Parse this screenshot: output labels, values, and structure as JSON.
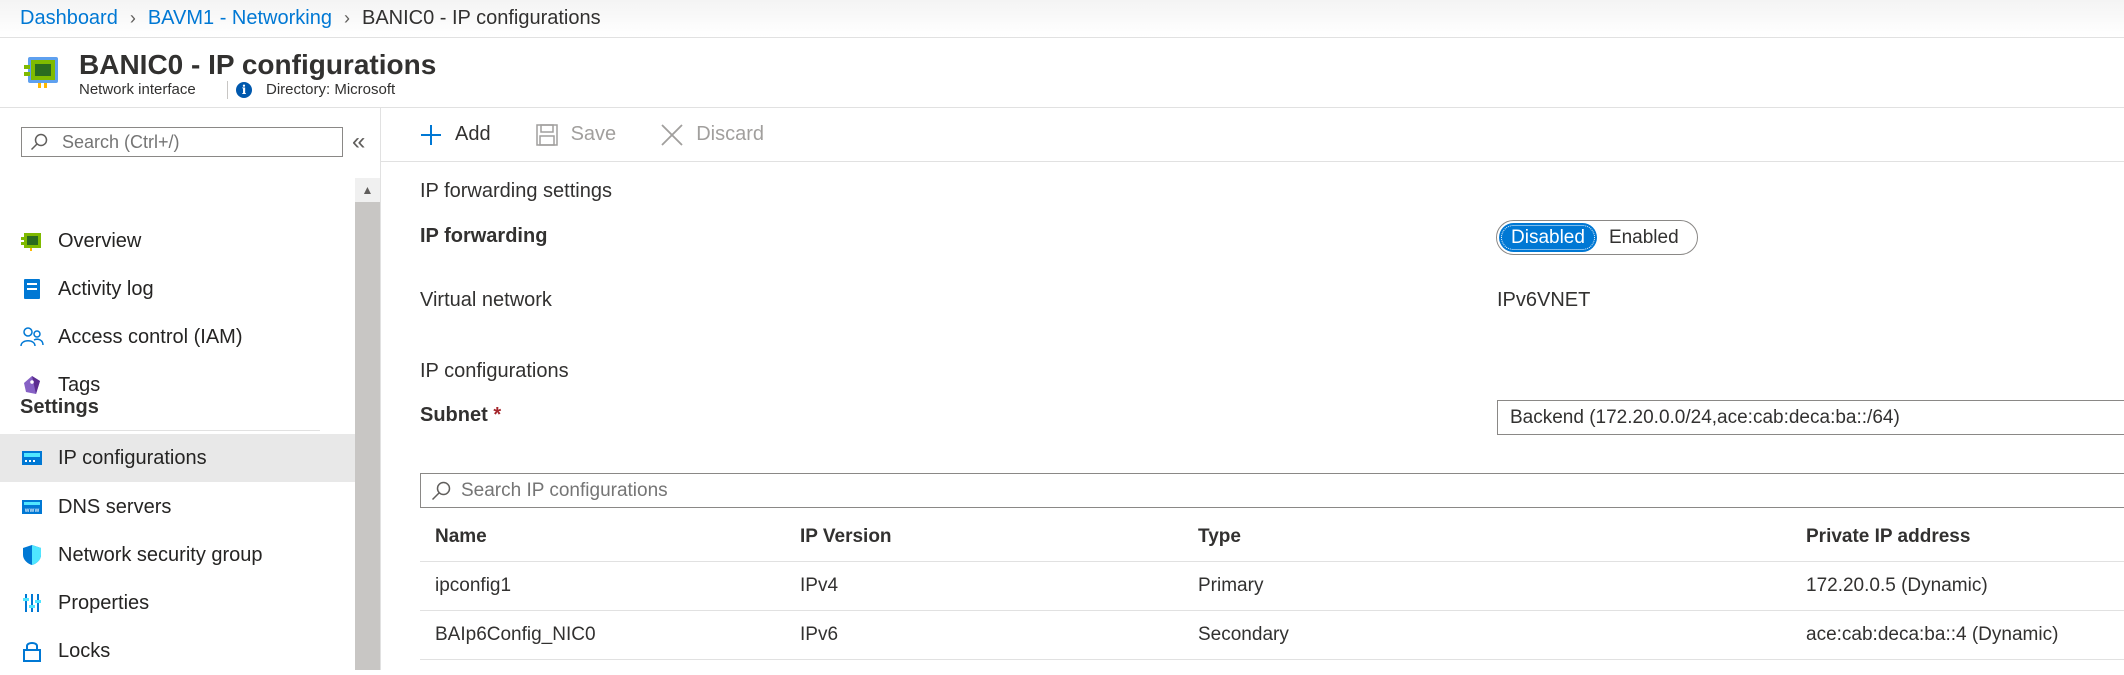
{
  "breadcrumb": {
    "items": [
      "Dashboard",
      "BAVM1 - Networking"
    ],
    "current": "BANIC0 - IP configurations"
  },
  "header": {
    "title": "BANIC0 - IP configurations",
    "subtitle": "Network interface",
    "directory": "Directory: Microsoft"
  },
  "sidebar": {
    "search_placeholder": "Search (Ctrl+/)",
    "items": [
      {
        "label": "Overview",
        "icon": "network-interface-icon"
      },
      {
        "label": "Activity log",
        "icon": "activity-log-icon"
      },
      {
        "label": "Access control (IAM)",
        "icon": "people-icon"
      },
      {
        "label": "Tags",
        "icon": "tag-icon"
      }
    ],
    "section": "Settings",
    "settings_items": [
      {
        "label": "IP configurations",
        "icon": "ip-config-icon",
        "active": true
      },
      {
        "label": "DNS servers",
        "icon": "dns-icon"
      },
      {
        "label": "Network security group",
        "icon": "shield-icon"
      },
      {
        "label": "Properties",
        "icon": "properties-icon"
      },
      {
        "label": "Locks",
        "icon": "lock-icon"
      }
    ]
  },
  "toolbar": {
    "add_label": "Add",
    "save_label": "Save",
    "discard_label": "Discard"
  },
  "main": {
    "ip_forwarding_section": "IP forwarding settings",
    "ip_forwarding_label": "IP forwarding",
    "toggle_disabled": "Disabled",
    "toggle_enabled": "Enabled",
    "toggle_selected": "Disabled",
    "virtual_network_label": "Virtual network",
    "virtual_network_value": "IPv6VNET",
    "ip_config_section": "IP configurations",
    "subnet_label": "Subnet",
    "subnet_required": "*",
    "subnet_value": "Backend (172.20.0.0/24,ace:cab:deca:ba::/64)",
    "search_placeholder": "Search IP configurations"
  },
  "table": {
    "headers": [
      "Name",
      "IP Version",
      "Type",
      "Private IP address"
    ],
    "rows": [
      [
        "ipconfig1",
        "IPv4",
        "Primary",
        "172.20.0.5 (Dynamic)"
      ],
      [
        "BAIp6Config_NIC0",
        "IPv6",
        "Secondary",
        "ace:cab:deca:ba::4 (Dynamic)"
      ]
    ]
  },
  "colors": {
    "accent": "#0078d4",
    "required": "#a4262c",
    "active_nav": "#e8e8e8"
  }
}
